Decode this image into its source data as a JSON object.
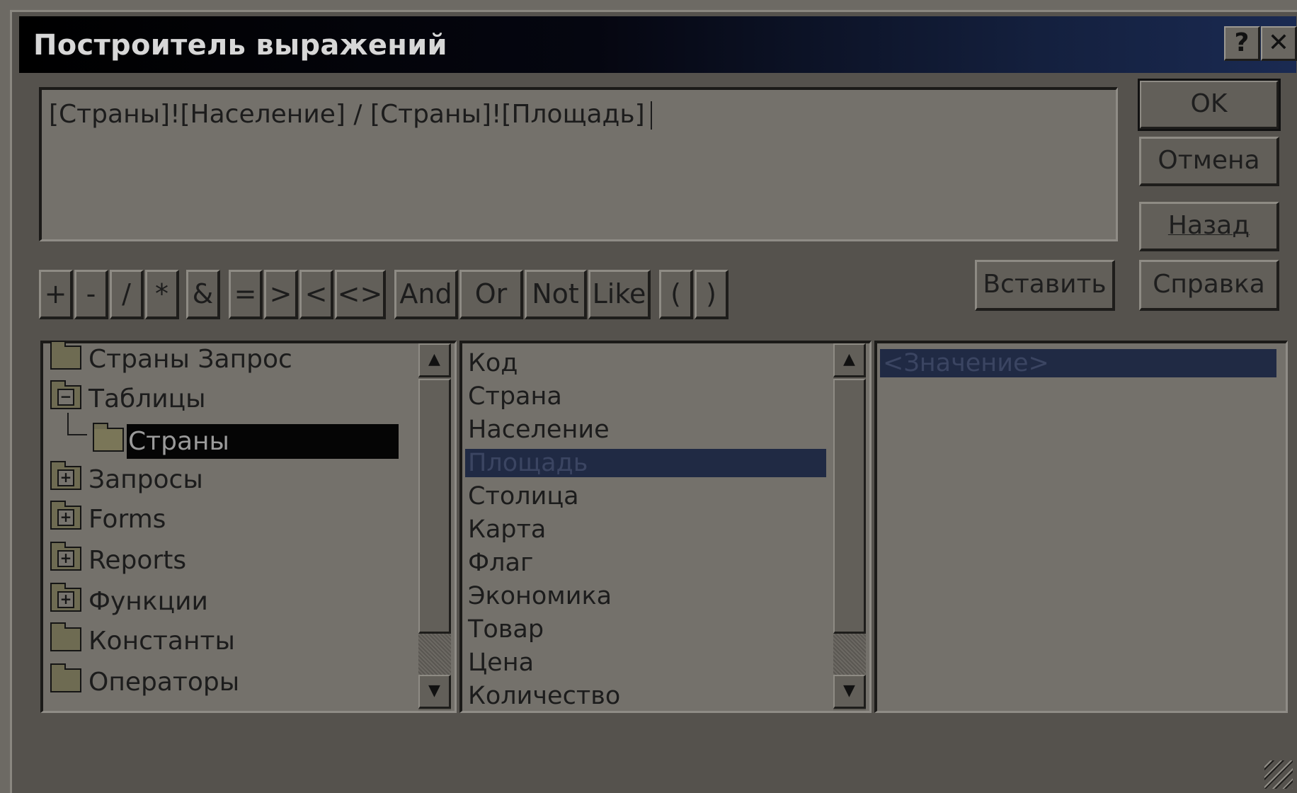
{
  "window": {
    "title": "Построитель выражений",
    "help_btn": "?",
    "close_btn": "✕"
  },
  "expression": {
    "value": "[Страны]![Население] / [Страны]![Площадь]"
  },
  "buttons": {
    "ok": "OK",
    "cancel": "Отмена",
    "back": "Назад",
    "insert": "Вставить",
    "help": "Справка"
  },
  "operators": [
    "+",
    "-",
    "/",
    "*",
    "&",
    "=",
    ">",
    "<",
    "<>",
    "And",
    "Or",
    "Not",
    "Like",
    "(",
    ")"
  ],
  "tree": {
    "items": [
      {
        "label": "Страны Запрос",
        "icon": "folder-icon"
      },
      {
        "label": "Таблицы",
        "icon": "folder-minus-icon"
      },
      {
        "label": "Страны",
        "icon": "folder-open-icon",
        "selected": true
      },
      {
        "label": "Запросы",
        "icon": "folder-plus-icon"
      },
      {
        "label": "Forms",
        "icon": "folder-plus-icon"
      },
      {
        "label": "Reports",
        "icon": "folder-plus-icon"
      },
      {
        "label": "Функции",
        "icon": "folder-plus-icon"
      },
      {
        "label": "Константы",
        "icon": "folder-icon"
      },
      {
        "label": "Операторы",
        "icon": "folder-icon"
      }
    ]
  },
  "fields": {
    "items": [
      "Код",
      "Страна",
      "Население",
      "Площадь",
      "Столица",
      "Карта",
      "Флаг",
      "Экономика",
      "Товар",
      "Цена",
      "Количество"
    ],
    "selected": "Площадь"
  },
  "values": {
    "items": [
      "<Значение>"
    ],
    "selected": "<Значение>"
  },
  "colors": {
    "dialog_bg": "#55524d",
    "title_gradient_end": "#1a2a52",
    "selection_blue": "#202a44"
  }
}
